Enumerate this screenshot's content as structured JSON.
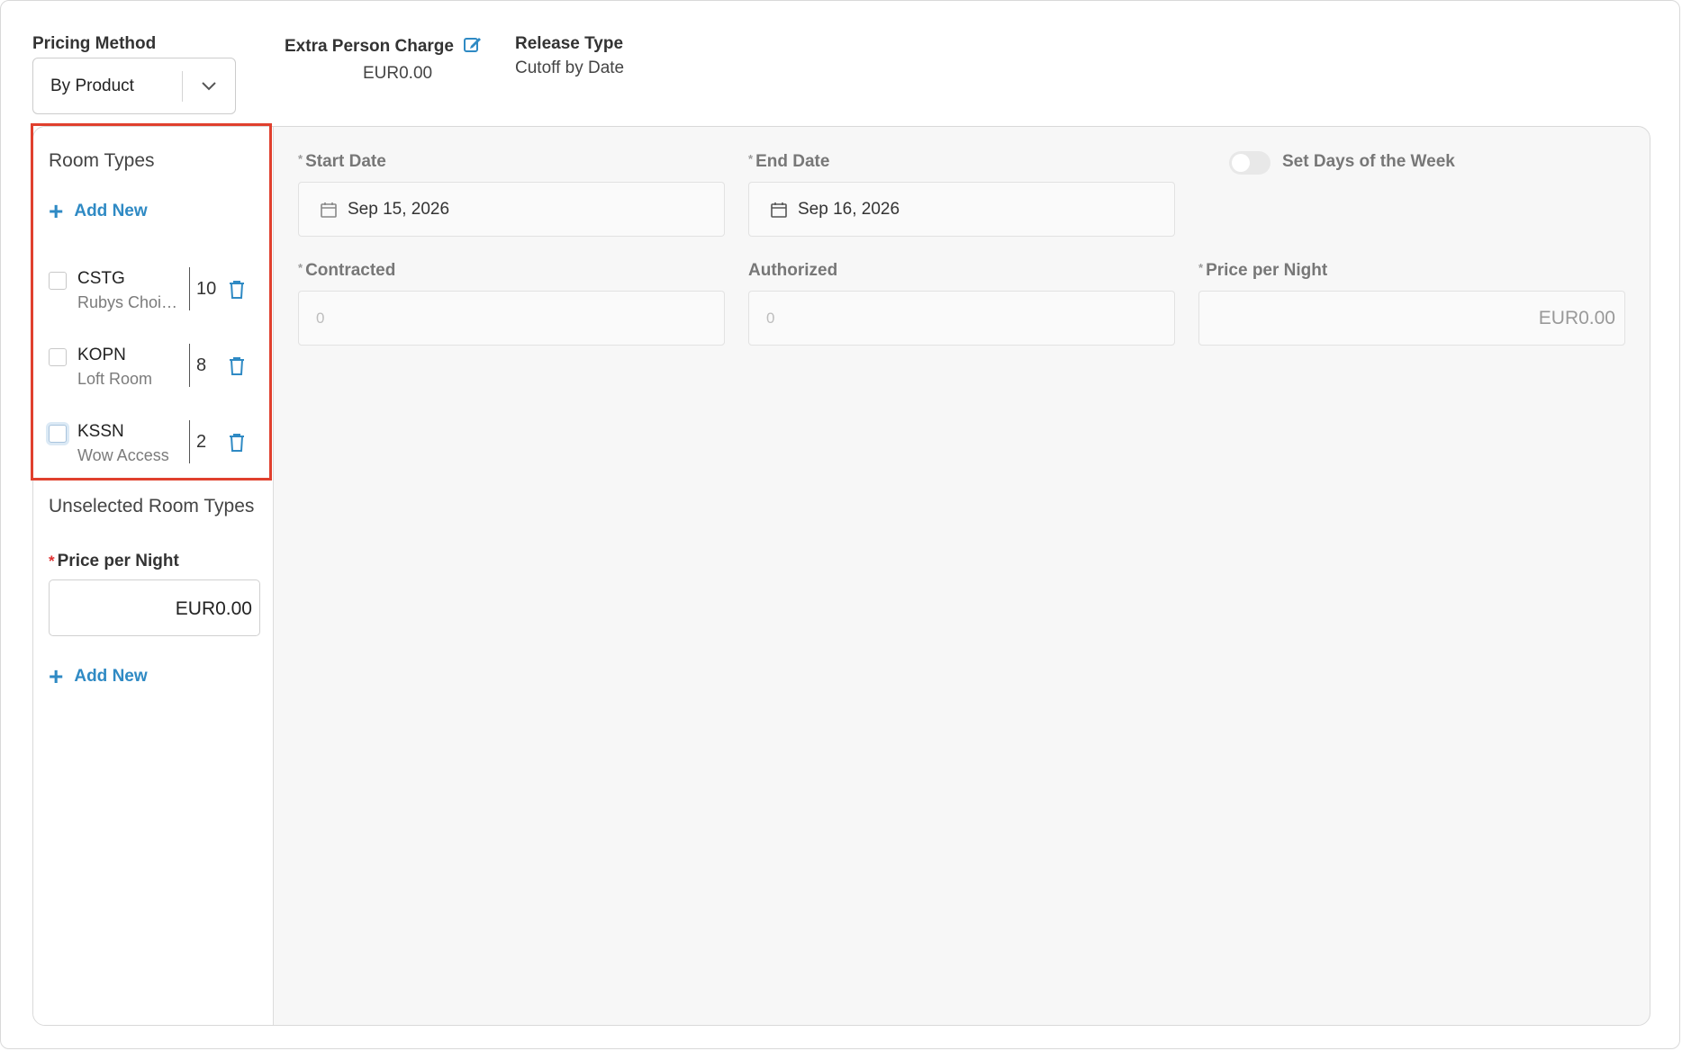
{
  "header": {
    "pricing_method_label": "Pricing Method",
    "pricing_method_value": "By Product",
    "extra_person_charge_label": "Extra Person Charge",
    "extra_person_charge_value": "EUR0.00",
    "release_type_label": "Release Type",
    "release_type_value": "Cutoff by Date"
  },
  "sidebar": {
    "room_types_title": "Room Types",
    "add_new_label": "Add New",
    "room_types": [
      {
        "code": "CSTG",
        "name": "Rubys Choice",
        "quantity": "10",
        "checked": false
      },
      {
        "code": "KOPN",
        "name": "Loft Room",
        "quantity": "8",
        "checked": false
      },
      {
        "code": "KSSN",
        "name": "Wow Access",
        "quantity": "2",
        "checked": false
      }
    ],
    "unselected_title": "Unselected Room Types",
    "price_per_night_label": "Price per Night",
    "price_per_night_value": "EUR0.00",
    "add_new_label_2": "Add New"
  },
  "form": {
    "start_date_label": "Start Date",
    "start_date_value": "Sep 15, 2026",
    "end_date_label": "End Date",
    "end_date_value": "Sep 16, 2026",
    "set_days_label": "Set Days of the Week",
    "set_days_enabled": false,
    "contracted_label": "Contracted",
    "contracted_placeholder": "0",
    "authorized_label": "Authorized",
    "authorized_placeholder": "0",
    "price_per_night_label": "Price per Night",
    "price_per_night_value": "EUR0.00"
  },
  "colors": {
    "accent": "#2f8ac4",
    "highlight_border": "#e0402e",
    "required": "#e03030"
  },
  "icons": {
    "chevron": "chevron-down-icon",
    "edit": "edit-icon",
    "calendar": "calendar-icon",
    "trash": "trash-icon",
    "plus": "plus-icon"
  }
}
